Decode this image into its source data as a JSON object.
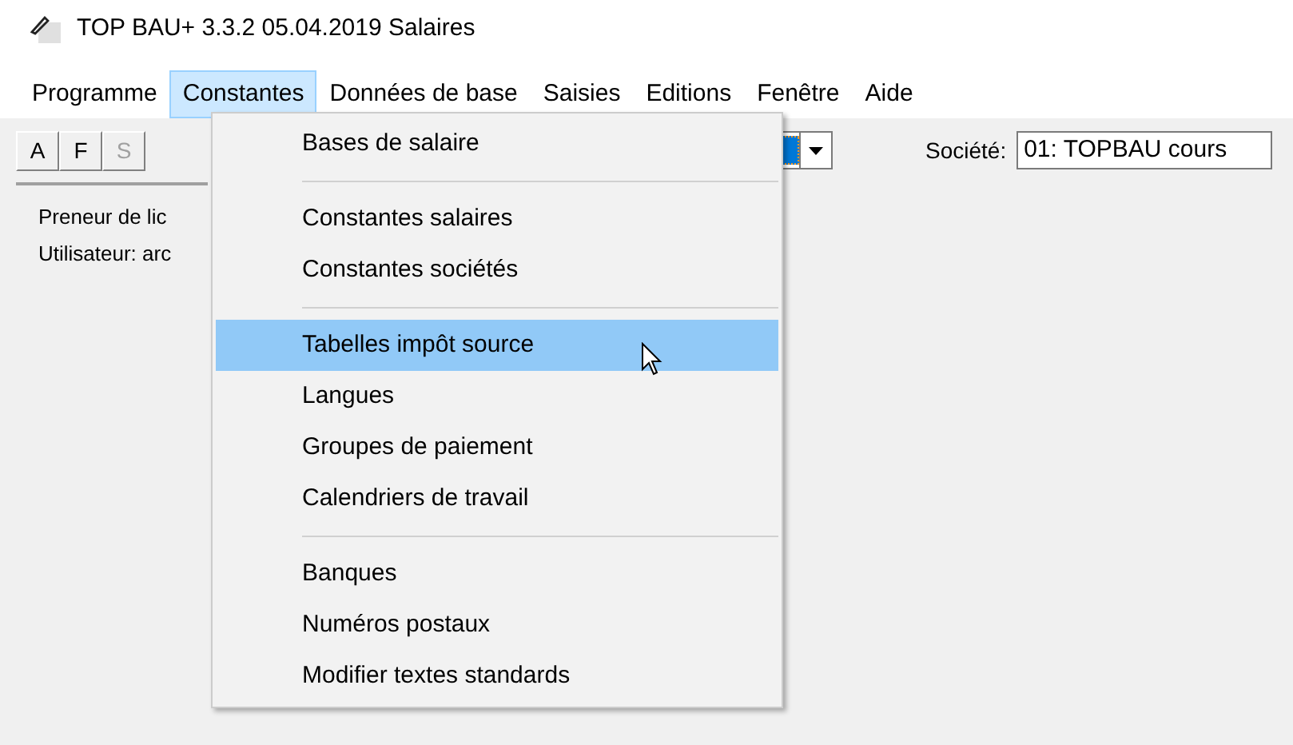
{
  "window": {
    "title": "TOP BAU+ 3.3.2  05.04.2019   Salaires"
  },
  "menu_bar": [
    {
      "label": "Programme",
      "selected": false
    },
    {
      "label": "Constantes",
      "selected": true
    },
    {
      "label": "Données de base",
      "selected": false
    },
    {
      "label": "Saisies",
      "selected": false
    },
    {
      "label": "Editions",
      "selected": false
    },
    {
      "label": "Fenêtre",
      "selected": false
    },
    {
      "label": "Aide",
      "selected": false
    }
  ],
  "toolbar": {
    "buttons": [
      {
        "label": "A",
        "disabled": false
      },
      {
        "label": "F",
        "disabled": false
      },
      {
        "label": "S",
        "disabled": true
      }
    ],
    "company_label": "Société:",
    "company_value": "01: TOPBAU cours"
  },
  "info_lines": [
    "Preneur de lic",
    "Utilisateur: arc"
  ],
  "dropdown": [
    {
      "kind": "item",
      "label": "Bases de salaire",
      "selected": false
    },
    {
      "kind": "separator"
    },
    {
      "kind": "item",
      "label": "Constantes salaires",
      "selected": false
    },
    {
      "kind": "item",
      "label": "Constantes sociétés",
      "selected": false
    },
    {
      "kind": "separator"
    },
    {
      "kind": "item",
      "label": "Tabelles impôt source",
      "selected": true
    },
    {
      "kind": "item",
      "label": "Langues",
      "selected": false
    },
    {
      "kind": "item",
      "label": "Groupes de paiement",
      "selected": false
    },
    {
      "kind": "item",
      "label": "Calendriers de travail",
      "selected": false
    },
    {
      "kind": "separator"
    },
    {
      "kind": "item",
      "label": "Banques",
      "selected": false
    },
    {
      "kind": "item",
      "label": "Numéros postaux",
      "selected": false
    },
    {
      "kind": "item",
      "label": "Modifier textes standards",
      "selected": false
    }
  ]
}
